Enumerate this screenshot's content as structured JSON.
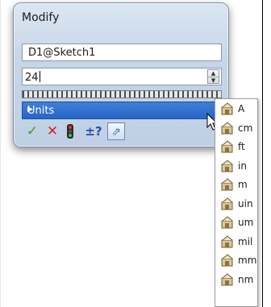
{
  "dialog": {
    "title": "Modify",
    "name_field": "D1@Sketch1",
    "value_field": "24",
    "units_label": "Units"
  },
  "actions": {
    "ok": "✓",
    "cancel": "✕",
    "reverse": "±?",
    "mark": "⇗"
  },
  "units_menu": {
    "items": [
      "A",
      "cm",
      "ft",
      "in",
      "m",
      "uin",
      "um",
      "mil",
      "mm",
      "nm"
    ]
  },
  "colors": {
    "accent": "#2766c6",
    "ok": "#3d9f2a",
    "cancel": "#d62222"
  }
}
